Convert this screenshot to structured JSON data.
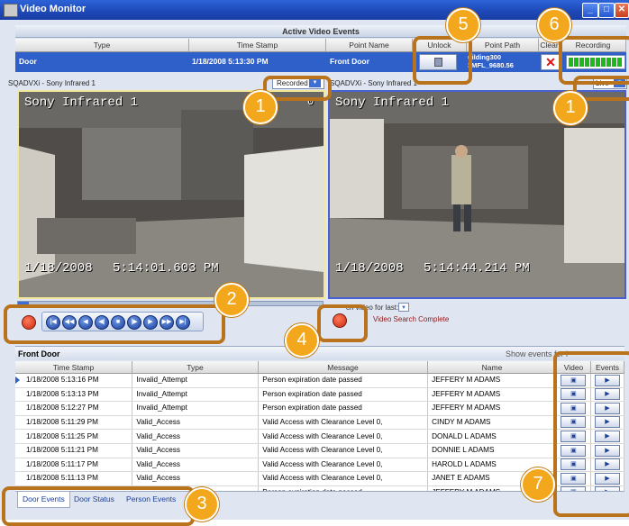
{
  "window": {
    "title": "Video Monitor"
  },
  "events_panel": {
    "title": "Active Video Events",
    "columns": [
      "Type",
      "Time Stamp",
      "Point Name",
      "Unlock",
      "Point Path",
      "Clear",
      "Recording"
    ],
    "row": {
      "type": "Door",
      "timestamp": "1/18/2008 5:13:30 PM",
      "point_name": "Front Door",
      "point_path_1": "uilding300",
      "point_path_2": "3MFL_9680.56"
    }
  },
  "left_video": {
    "caption": "SQADVXi - Sony Infrared 1",
    "mode": "Recorded",
    "overlay_name": "Sony Infrared 1",
    "overlay_date": "1/18/2008",
    "overlay_time": "5:14:01.603 PM",
    "corner": "0"
  },
  "right_video": {
    "caption": "SQADVXi - Sony Infrared 1",
    "mode": "Live",
    "overlay_name": "Sony Infrared 1",
    "overlay_date": "1/18/2008",
    "overlay_time": "5:14:44.214 PM"
  },
  "search": {
    "label": "ch video for last:",
    "status": "Video Search Complete"
  },
  "door_events": {
    "title": "Front Door",
    "show_events_label": "Show events for l",
    "columns": [
      "Time Stamp",
      "Type",
      "Message",
      "Name",
      "Video",
      "Events"
    ],
    "rows": [
      {
        "ts": "1/18/2008 5:13:16 PM",
        "type": "Invalid_Attempt",
        "msg": "Person expiration date passed",
        "name": "JEFFERY M ADAMS"
      },
      {
        "ts": "1/18/2008 5:13:13 PM",
        "type": "Invalid_Attempt",
        "msg": "Person expiration date passed",
        "name": "JEFFERY M ADAMS"
      },
      {
        "ts": "1/18/2008 5:12:27 PM",
        "type": "Invalid_Attempt",
        "msg": "Person expiration date passed",
        "name": "JEFFERY M ADAMS"
      },
      {
        "ts": "1/18/2008 5:11:29 PM",
        "type": "Valid_Access",
        "msg": "Valid Access with Clearance Level 0,",
        "name": "CINDY M ADAMS"
      },
      {
        "ts": "1/18/2008 5:11:25 PM",
        "type": "Valid_Access",
        "msg": "Valid Access with Clearance Level 0,",
        "name": "DONALD L ADAMS"
      },
      {
        "ts": "1/18/2008 5:11:21 PM",
        "type": "Valid_Access",
        "msg": "Valid Access with Clearance Level 0,",
        "name": "DONNIE L ADAMS"
      },
      {
        "ts": "1/18/2008 5:11:17 PM",
        "type": "Valid_Access",
        "msg": "Valid Access with Clearance Level 0,",
        "name": "HAROLD L ADAMS"
      },
      {
        "ts": "1/18/2008 5:11:13 PM",
        "type": "Valid_Access",
        "msg": "Valid Access with Clearance Level 0,",
        "name": "JANET E ADAMS"
      },
      {
        "ts": "",
        "type": "",
        "msg": "Person expiration date passed",
        "name": "JEFFERY M ADAMS"
      }
    ]
  },
  "tabs": [
    "Door Events",
    "Door Status",
    "Person Events"
  ],
  "callouts": [
    "1",
    "1",
    "2",
    "3",
    "4",
    "5",
    "6",
    "7"
  ],
  "colors": {
    "accent": "#f3a71d",
    "highlight_border": "#b8731c",
    "selection": "#2f5fc8",
    "title_bar": "#1c47b5"
  }
}
